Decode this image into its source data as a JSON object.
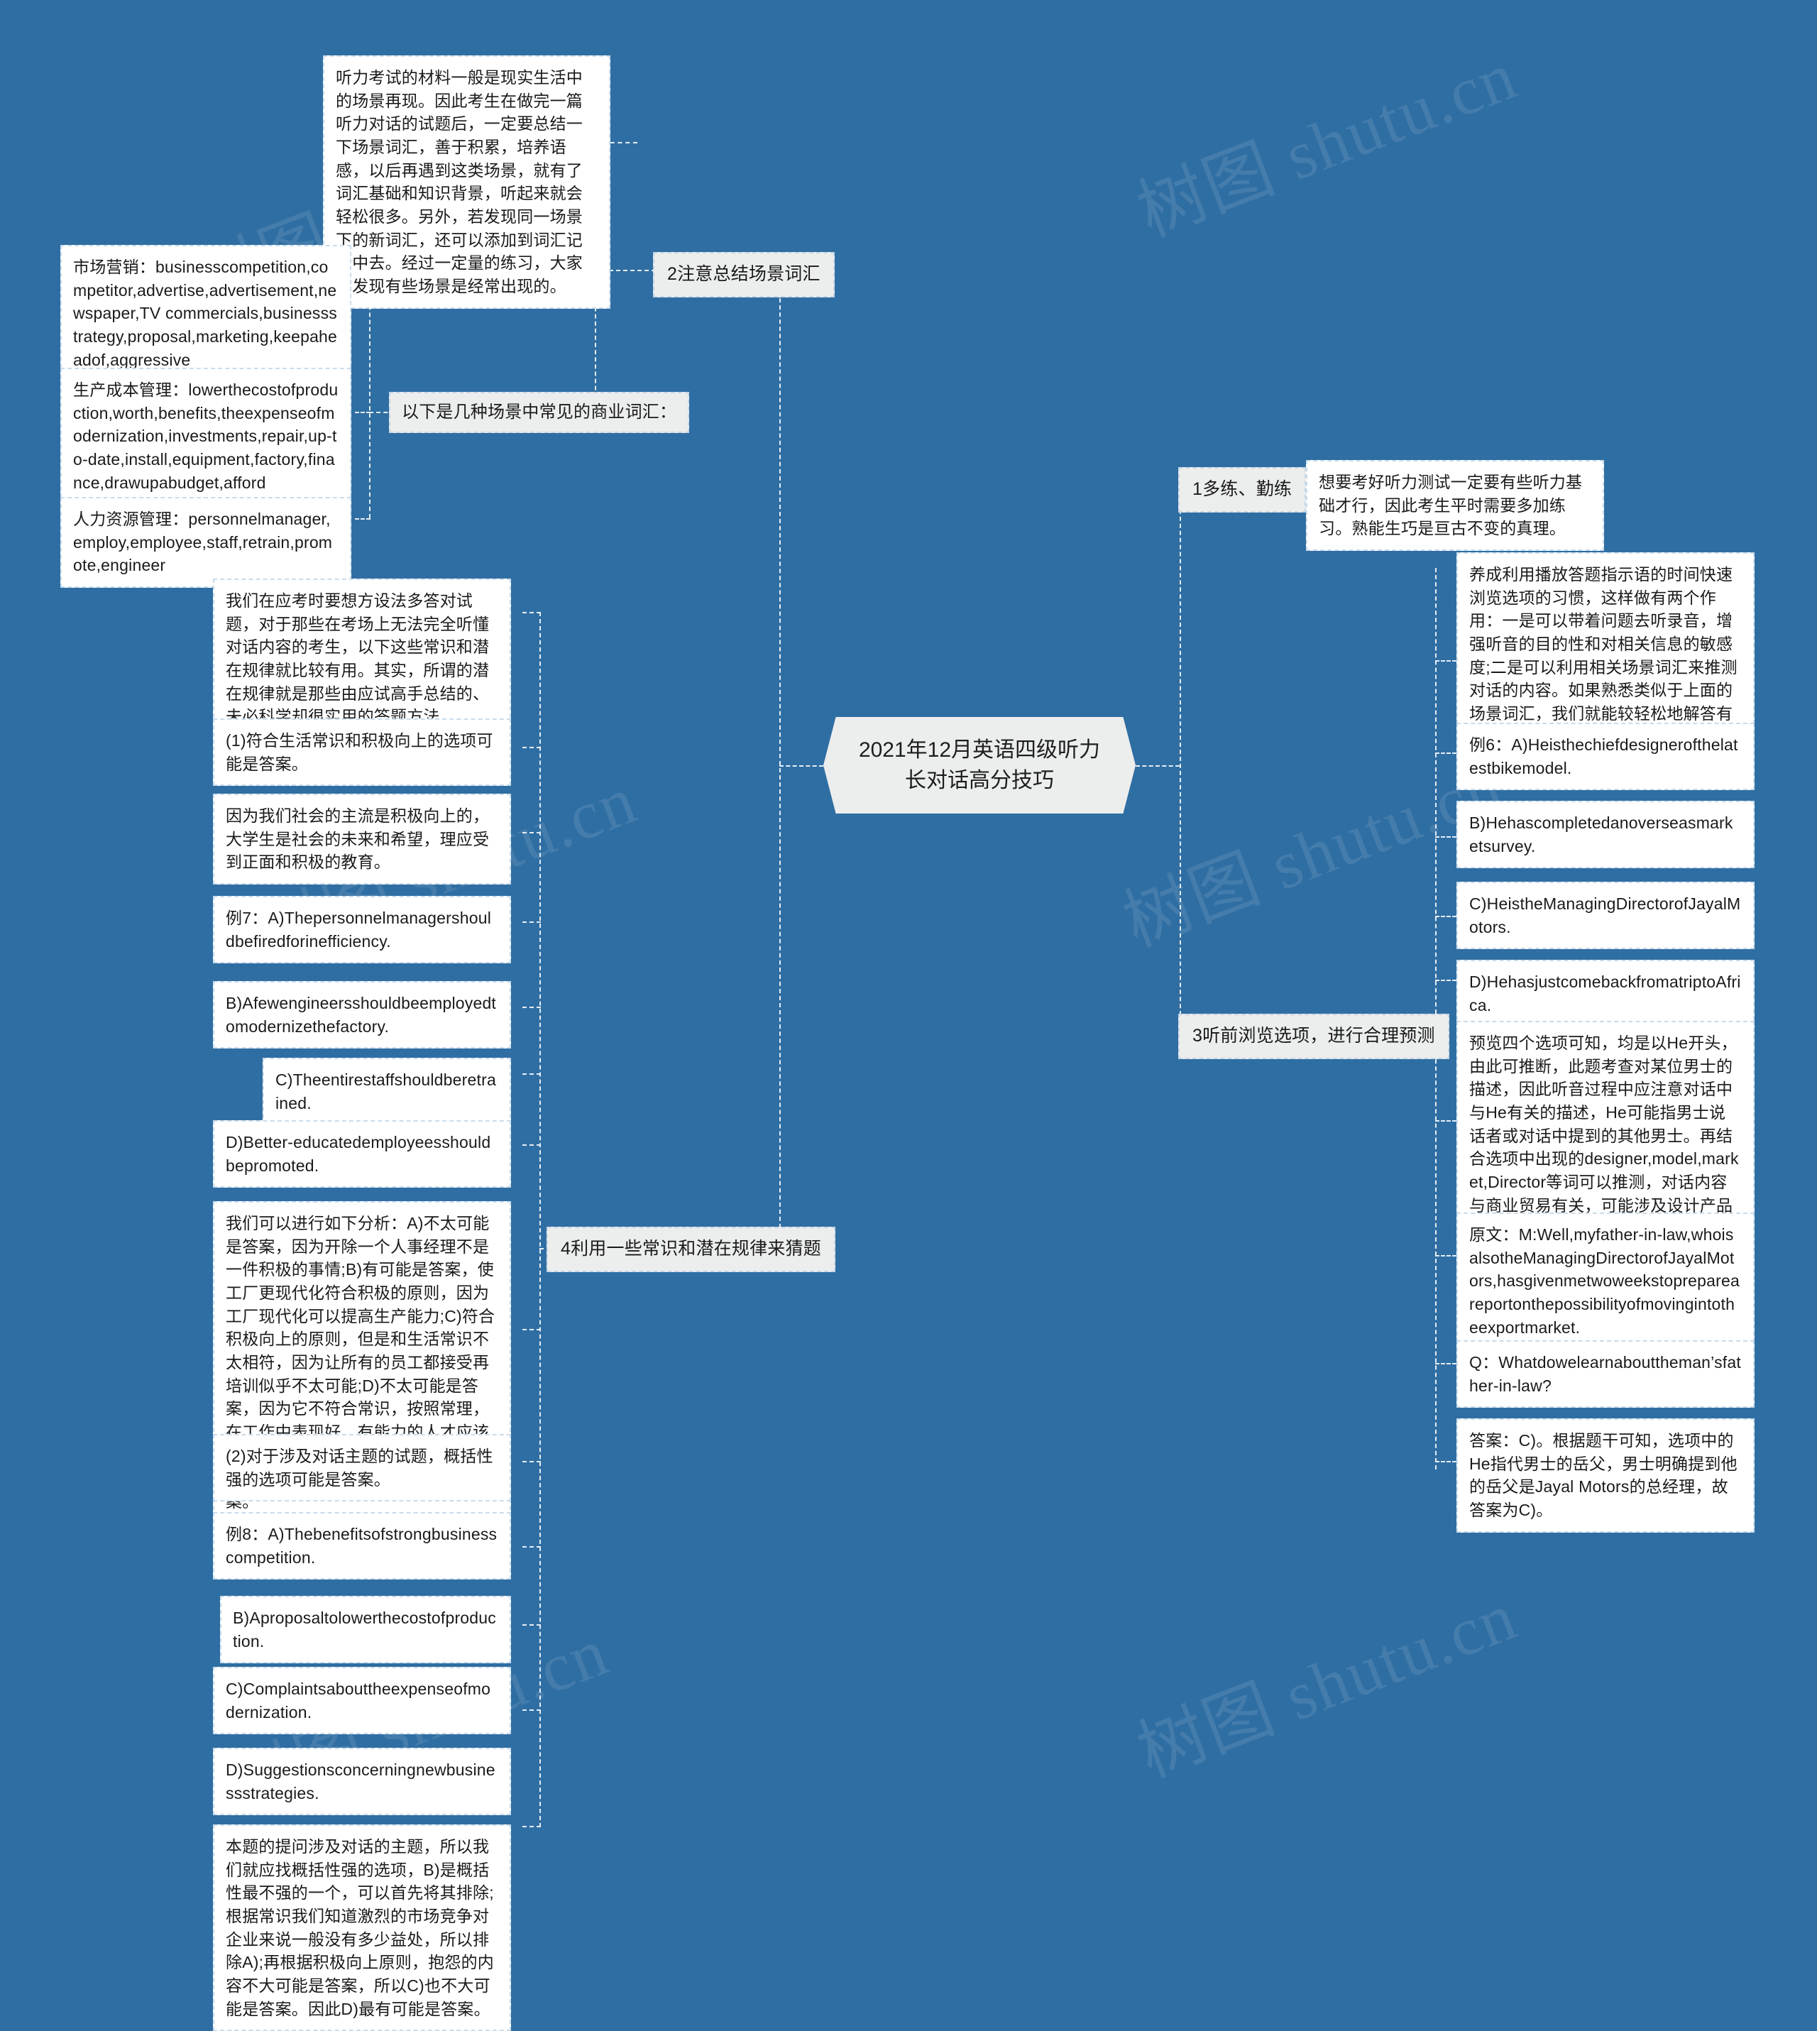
{
  "root": {
    "title": "2021年12月英语四级听力长对话高分技巧"
  },
  "watermarks": [
    {
      "text": "树图 shutu.cn"
    },
    {
      "text": "树图 shutu.cn"
    },
    {
      "text": "树图 shutu.cn"
    },
    {
      "text": "树图 shutu.cn"
    },
    {
      "text": "树图 shutu.cn"
    },
    {
      "text": "树图 shutu.cn"
    }
  ],
  "branches": {
    "b1": {
      "label": "1多练、勤练",
      "detail": "想要考好听力测试一定要有些听力基础才行，因此考生平时需要多加练习。熟能生巧是亘古不变的真理。"
    },
    "b2": {
      "label": "2注意总结场景词汇",
      "intro": "听力考试的材料一般是现实生活中的场景再现。因此考生在做完一篇听力对话的试题后，一定要总结一下场景词汇，善于积累，培养语感，以后再遇到这类场景，就有了词汇基础和知识背景，听起来就会轻松很多。另外，若发现同一场景下的新词汇，还可以添加到词汇记录中去。经过一定量的练习，大家会发现有些场景是经常出现的。",
      "vocab_label": "以下是几种场景中常见的商业词汇：",
      "vocab_items": [
        "市场营销：businesscompetition,competitor,advertise,advertisement,newspaper,TV commercials,businessstrategy,proposal,marketing,keepaheadof,aggressive",
        "生产成本管理：lowerthecostofproduction,worth,benefits,theexpenseofmodernization,investments,repair,up-to-date,install,equipment,factory,finance,drawupabudget,afford",
        "人力资源管理：personnelmanager,employ,employee,staff,retrain,promote,engineer"
      ]
    },
    "b3": {
      "label": "3听前浏览选项，进行合理预测",
      "detail": "养成利用播放答题指示语的时间快速浏览选项的习惯，这样做有两个作用：一是可以带着问题去听录音，增强听音的目的性和对相关信息的敏感度;二是可以利用相关场景词汇来推测对话的内容。如果熟悉类似于上面的场景词汇，我们就能较轻松地解答有关对话主题的试题。",
      "items": [
        "例6：A)Heisthechiefdesignerofthelatestbikemodel.",
        "B)Hehascompletedanoverseasmarketsurvey.",
        "C)HeistheManagingDirectorofJayalMotors.",
        "D)HehasjustcomebackfromatriptoAfrica.",
        "预览四个选项可知，均是以He开头，由此可推断，此题考查对某位男士的描述，因此听音过程中应注意对话中与He有关的描述，He可能指男士说话者或对话中提到的其他男士。再结合选项中出现的designer,model,market,Director等词可以推测，对话内容与商业贸易有关，可能涉及设计产品模型、投放市场等方面。",
        "原文：M:Well,myfather-in-law,whoisalsotheManagingDirectorofJayalMotors,hasgivenmetwoweekstoprepareareportonthepossibilityofmovingintotheexportmarket.",
        "Q：Whatdowelearnabouttheman’sfather-in-law?",
        "答案：C)。根据题干可知，选项中的He指代男士的岳父，男士明确提到他的岳父是Jayal Motors的总经理，故答案为C)。"
      ]
    },
    "b4": {
      "label": "4利用一些常识和潜在规律来猜题",
      "items": [
        "我们在应考时要想方设法多答对试题，对于那些在考场上无法完全听懂对话内容的考生，以下这些常识和潜在规律就比较有用。其实，所谓的潜在规律就是那些由应试高手总结的、未必科学却很实用的答题方法。",
        "(1)符合生活常识和积极向上的选项可能是答案。",
        "因为我们社会的主流是积极向上的，大学生是社会的未来和希望，理应受到正面和积极的教育。",
        "例7：A)Thepersonnelmanagershouldbefiredforinefficiency.",
        "B)Afewengineersshouldbeemployedtomodernizethefactory.",
        "C)Theentirestaffshouldberetrained.",
        "D)Better-educatedemployeesshouldbepromoted.",
        "我们可以进行如下分析：A)不太可能是答案，因为开除一个人事经理不是一件积极的事情;B)有可能是答案，使工厂更现代化符合积极的原则，因为工厂现代化可以提高生产能力;C)符合积极向上的原则，但是和生活常识不太相符，因为让所有的员工都接受再培训似乎不太可能;D)不太可能是答案，因为它不符合常识，按照常理，在工作中表现好、有能力的人才应该被提拔，而不是受到较好教育的员工应该被提拔。因此，B)最有可能是答案。",
        "(2)对于涉及对话主题的试题，概括性强的选项可能是答案。",
        "例8：A)Thebenefitsofstrongbusinesscompetition.",
        "B)Aproposaltolowerthecostofproduction.",
        "C)Complaintsabouttheexpenseofmodernization.",
        "D)Suggestionsconcerningnewbusinessstrategies.",
        "本题的提问涉及对话的主题，所以我们就应找概括性强的选项，B)是概括性最不强的一个，可以首先将其排除;根据常识我们知道激烈的市场竞争对企业来说一般没有多少益处，所以排除A);再根据积极向上原则，抱怨的内容不大可能是答案，所以C)也不大可能是答案。因此D)最有可能是答案。"
      ]
    }
  },
  "colors": {
    "background": "#2f6ea3",
    "node_bg": "#ffffff",
    "topic_bg": "#eceded",
    "line": "#e6eef6",
    "text": "#1a1a1a"
  }
}
